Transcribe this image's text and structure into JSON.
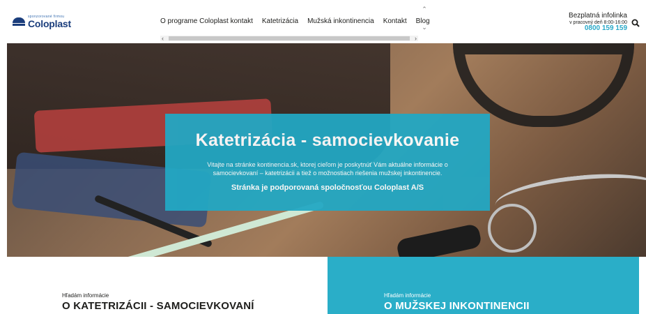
{
  "header": {
    "logo": {
      "sponsor_text": "sponzorované firmou",
      "brand": "Coloplast"
    },
    "nav": [
      {
        "label": "O programe Coloplast kontakt"
      },
      {
        "label": "Katetrizácia"
      },
      {
        "label": "Mužská inkontinencia"
      },
      {
        "label": "Kontakt"
      },
      {
        "label": "Blog"
      }
    ],
    "infoline": {
      "title": "Bezplatná infolinka",
      "hours": "v pracovný deň 8:00-16:00",
      "phone": "0800 159 159"
    },
    "icons": {
      "search": "search-icon",
      "scroll_up": "chevron-up-icon",
      "scroll_down": "chevron-down-icon",
      "scroll_left": "chevron-left-icon",
      "scroll_right": "chevron-right-icon"
    }
  },
  "hero": {
    "title": "Katetrizácia - samocievkovanie",
    "text": "Vitajte na stránke kontinencia.sk, ktorej cieľom je poskytnúť Vám aktuálne informácie o samocievkovaní – katetrizácii a tiež o možnostiach riešenia mužskej inkontinencie.",
    "sponsor": "Stránka je podporovaná spoločnosťou Coloplast A/S"
  },
  "cards": [
    {
      "kicker": "Hľadám informácie",
      "title": "O KATETRIZÁCII - SAMOCIEVKOVANÍ"
    },
    {
      "kicker": "Hľadám informácie",
      "title": "O MUŽSKEJ INKONTINENCII"
    }
  ],
  "colors": {
    "accent": "#22a8c4",
    "brand": "#1a3d7c",
    "phone": "#2aa9c8"
  }
}
